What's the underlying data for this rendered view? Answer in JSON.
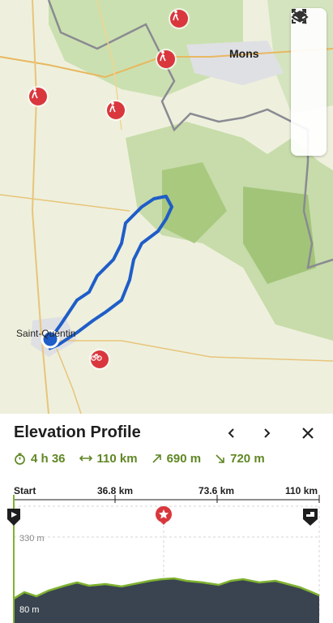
{
  "map": {
    "places": {
      "mons": "Mons",
      "saint_quentin": "Saint-Quentin"
    },
    "tools": [
      {
        "name": "locate-icon"
      },
      {
        "name": "layers-icon"
      },
      {
        "name": "focus-icon"
      },
      {
        "name": "hide-icon"
      }
    ],
    "poi_colors": {
      "hike": "#d9373d",
      "route": "#1f5dc8"
    }
  },
  "panel": {
    "title": "Elevation Profile",
    "stats": {
      "duration": "4 h 36",
      "distance": "110 km",
      "ascent": "690 m",
      "descent": "720 m"
    },
    "distance_ticks": [
      "Start",
      "36.8 km",
      "73.6 km",
      "110 km"
    ],
    "elevation_labels": {
      "max": "330 m",
      "min": "80 m"
    },
    "colors": {
      "accent": "#5f8724",
      "marker": "#d9373d",
      "terrain": "#3a4450"
    }
  }
}
